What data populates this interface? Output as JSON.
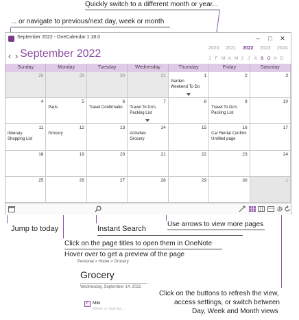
{
  "annotations": {
    "quick_switch": "Quickly switch to a different month or year...",
    "navigate": "... or navigate to previous/next day, week or month",
    "jump_today": "Jump to today",
    "instant_search": "Instant Search",
    "arrows_more": "Use arrows to view more pages",
    "click_titles": "Click on the page titles to open them in OneNote",
    "hover_preview": "Hover over to get a preview of the page",
    "buttons_line1": "Click on the buttons to refresh the view,",
    "buttons_line2": "access settings, or switch between",
    "buttons_line3": "Day, Week and Month views"
  },
  "window": {
    "title": "September 2022 - OneCalendar 1.18.0",
    "controls": [
      "–",
      "□",
      "✕"
    ],
    "nav_arrows": "‹ ›",
    "month_title": "September 2022",
    "years": [
      "2020",
      "2021",
      "2022",
      "2023",
      "2024"
    ],
    "current_year": "2022",
    "months": [
      "J",
      "F",
      "M",
      "A",
      "M",
      "J",
      "J",
      "A",
      "S",
      "O",
      "N",
      "D"
    ],
    "selected_month_index": 8
  },
  "weekdays": [
    "Sunday",
    "Monday",
    "Tuesday",
    "Wednesday",
    "Thursday",
    "Friday",
    "Saturday"
  ],
  "weeks": [
    [
      {
        "d": "28",
        "o": true,
        "e": []
      },
      {
        "d": "29",
        "o": true,
        "e": []
      },
      {
        "d": "30",
        "o": true,
        "e": []
      },
      {
        "d": "31",
        "o": true,
        "e": []
      },
      {
        "d": "1",
        "e": [
          "Garden",
          "Weekend To Do"
        ],
        "more": true
      },
      {
        "d": "2",
        "e": []
      },
      {
        "d": "3",
        "e": []
      }
    ],
    [
      {
        "d": "4",
        "e": []
      },
      {
        "d": "5",
        "e": [
          "Paris"
        ]
      },
      {
        "d": "6",
        "e": [
          "Travel Confirmatio"
        ]
      },
      {
        "d": "7",
        "e": [
          "Travel To Do's",
          "Packing List"
        ],
        "more": true
      },
      {
        "d": "8",
        "e": []
      },
      {
        "d": "9",
        "e": [
          "Travel To Do's",
          "Packing List"
        ]
      },
      {
        "d": "10",
        "e": []
      }
    ],
    [
      {
        "d": "11",
        "e": [
          "Itinerary",
          "Shopping List"
        ]
      },
      {
        "d": "12",
        "e": [
          "Grocery"
        ]
      },
      {
        "d": "13",
        "e": []
      },
      {
        "d": "14",
        "e": [
          "Activities",
          "Grocery"
        ]
      },
      {
        "d": "15",
        "e": []
      },
      {
        "d": "16",
        "e": [
          "Car Rental Confirm",
          "Untitled page"
        ]
      },
      {
        "d": "17",
        "e": []
      }
    ],
    [
      {
        "d": "18",
        "e": []
      },
      {
        "d": "19",
        "e": []
      },
      {
        "d": "20",
        "e": []
      },
      {
        "d": "21",
        "e": []
      },
      {
        "d": "22",
        "e": []
      },
      {
        "d": "23",
        "e": []
      },
      {
        "d": "24",
        "e": []
      }
    ],
    [
      {
        "d": "25",
        "e": []
      },
      {
        "d": "26",
        "e": []
      },
      {
        "d": "27",
        "e": []
      },
      {
        "d": "28",
        "e": []
      },
      {
        "d": "29",
        "e": []
      },
      {
        "d": "30",
        "e": []
      },
      {
        "d": "1",
        "o": true,
        "today": true,
        "e": []
      }
    ]
  ],
  "preview": {
    "breadcrumb": "Personal > Home > Grocery",
    "title": "Grocery",
    "date": "Wednesday, September 14, 2022",
    "item": "Milk",
    "item_sub": "Whole or high fat, ..."
  },
  "colors": {
    "accent": "#7a3b8f",
    "header_bg": "#dfcbe8",
    "other_month": "#e9e9e9"
  },
  "icons": [
    "calendar-today-icon",
    "search-icon",
    "arrows-icon",
    "month-view-icon",
    "week-view-icon",
    "settings-icon",
    "refresh-icon"
  ]
}
